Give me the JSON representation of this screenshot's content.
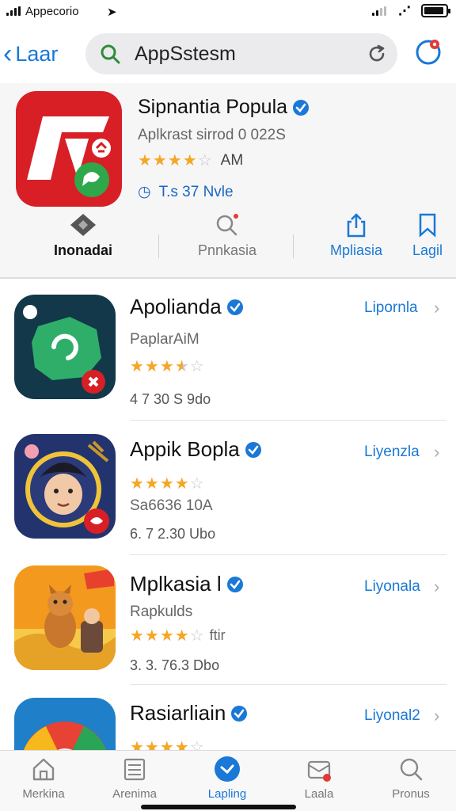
{
  "status_bar": {
    "carrier": "Appecorio"
  },
  "nav": {
    "back_label": "Laar",
    "search": {
      "value": "AppSstesm",
      "placeholder": ""
    }
  },
  "featured": {
    "name": "Sipnantia Popula",
    "subtitle": "Aplkrast sirrod 0 022S",
    "rating": 4,
    "rating_text": "AM",
    "meta": "T.s 37 Nvle",
    "actions": [
      {
        "label": "Inonadai",
        "icon": "diamond-icon"
      },
      {
        "label": "Pnnkasia",
        "icon": "search-icon"
      },
      {
        "label": "Mpliasia",
        "icon": "share-icon"
      },
      {
        "label": "Lagil",
        "icon": "bookmark-icon"
      }
    ]
  },
  "apps": [
    {
      "title": "Apolianda",
      "category": "PaplarAiM",
      "rating": 3.5,
      "rating_extra": "",
      "meta": "4  7  30 S  9do",
      "action": "Lipornla",
      "icon": "chat-app-icon"
    },
    {
      "title": "Appik Bopla",
      "category": "Sa6636 10A",
      "rating": 4,
      "rating_extra": "",
      "meta": "6. 7  2.30  Ubo",
      "action": "Liyenzla",
      "icon": "character-app-icon"
    },
    {
      "title": "Mplkasia l",
      "category": "Rapkulds",
      "rating": 4,
      "rating_extra": "ftir",
      "meta": "3. 3. 76.3  Dbo",
      "action": "Liyonala",
      "icon": "game-app-icon"
    },
    {
      "title": "Rasiarliain",
      "category": "",
      "rating": 4,
      "rating_extra": "",
      "meta": "",
      "action": "Liyonal2",
      "icon": "colors-app-icon"
    }
  ],
  "tabs": [
    {
      "label": "Merkina",
      "icon": "home-icon",
      "active": false
    },
    {
      "label": "Arenima",
      "icon": "list-icon",
      "active": false
    },
    {
      "label": "Lapling",
      "icon": "apps-icon",
      "active": true
    },
    {
      "label": "Laala",
      "icon": "inbox-icon",
      "active": false
    },
    {
      "label": "Pronus",
      "icon": "search-icon",
      "active": false
    }
  ],
  "colors": {
    "accent": "#1a78d6",
    "star": "#f5a623",
    "featured_icon_bg": "#d81f26"
  }
}
